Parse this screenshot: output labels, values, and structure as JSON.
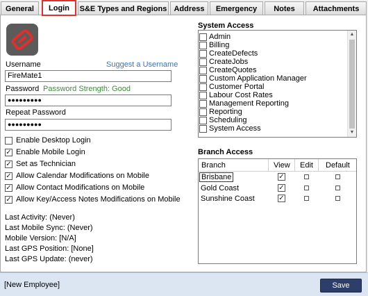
{
  "tabs": [
    "General",
    "Login",
    "S&E Types and Regions",
    "Address",
    "Emergency",
    "Notes",
    "Attachments"
  ],
  "login": {
    "username_label": "Username",
    "suggest_label": "Suggest a Username",
    "username_value": "FireMate1",
    "password_label": "Password",
    "password_strength": "Password Strength: Good",
    "password_value": "●●●●●●●●●",
    "repeat_label": "Repeat Password",
    "repeat_value": "●●●●●●●●●",
    "options": [
      {
        "label": "Enable Desktop Login",
        "checked": false
      },
      {
        "label": "Enable Mobile Login",
        "checked": true
      },
      {
        "label": "Set as Technician",
        "checked": true
      },
      {
        "label": "Allow Calendar Modifications on Mobile",
        "checked": true
      },
      {
        "label": "Allow Contact Modifications on Mobile",
        "checked": true
      },
      {
        "label": "Allow Key/Access Notes Modifications on Mobile",
        "checked": true
      }
    ],
    "status": [
      "Last Activity: (Never)",
      "Last Mobile Sync: (Never)",
      "Mobile Version: [N/A]",
      "Last GPS Position: [None]",
      "Last GPS Update: (never)"
    ]
  },
  "system_access": {
    "title": "System Access",
    "items": [
      "Admin",
      "Billing",
      "CreateDefects",
      "CreateJobs",
      "CreateQuotes",
      "Custom Application Manager",
      "Customer Portal",
      "Labour Cost Rates",
      "Management Reporting",
      "Reporting",
      "Scheduling",
      "System Access"
    ]
  },
  "branch_access": {
    "title": "Branch Access",
    "headers": {
      "branch": "Branch",
      "view": "View",
      "edit": "Edit",
      "default": "Default"
    },
    "rows": [
      {
        "name": "Brisbane",
        "view": true,
        "edit": false,
        "default": false
      },
      {
        "name": "Gold Coast",
        "view": true,
        "edit": false,
        "default": false
      },
      {
        "name": "Sunshine Coast",
        "view": true,
        "edit": false,
        "default": false
      }
    ]
  },
  "footer": {
    "employee": "[New Employee]",
    "save_label": "Save"
  },
  "colors": {
    "active_tab_outline": "#e0302b",
    "save_button": "#2e3e6a",
    "link": "#3a74b9",
    "strength_good": "#3b8d3b",
    "footer_bg": "#dce6f2"
  },
  "icons": {
    "logo": "app-logo-icon",
    "scroll_up": "chevron-up-icon",
    "scroll_down": "chevron-down-icon"
  }
}
